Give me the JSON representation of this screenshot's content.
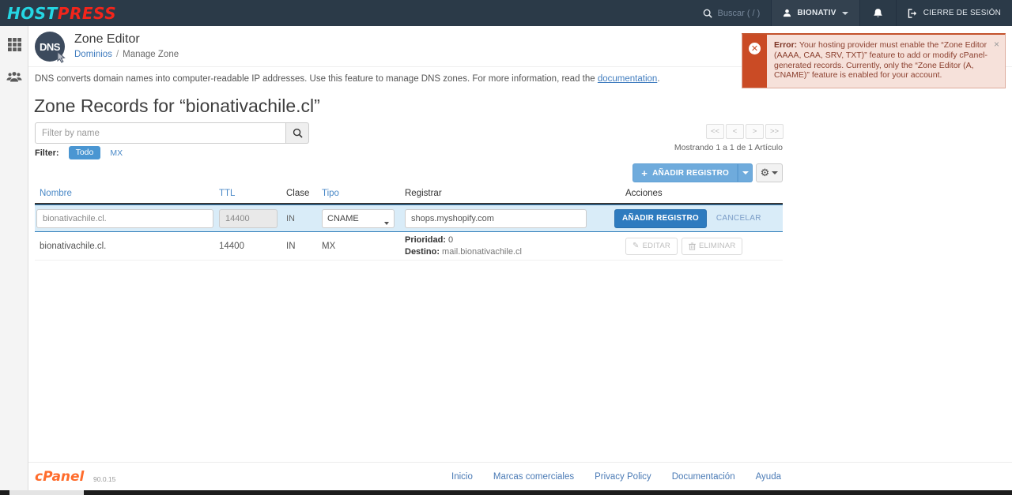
{
  "colors": {
    "topbar_bg": "#2b3a48",
    "logo_cyan": "#25d6e3",
    "logo_red": "#f3251b",
    "link_blue": "#417dbf",
    "primary_button": "#2e7bbf",
    "light_add_button": "#6fabdc",
    "alert_red": "#ca4b25",
    "alert_bg": "#f6e1da",
    "edit_row_bg": "#d9ecf8",
    "cpanel_orange": "#ff6c2c"
  },
  "topbar": {
    "logo_part1": "HOST",
    "logo_part2": "PRESS",
    "search_placeholder": "Buscar ( / )",
    "user_label": "BIONATIV",
    "logout_label": "CIERRE DE SESIÓN"
  },
  "header": {
    "badge_text": "DNS",
    "title": "Zone Editor",
    "breadcrumb_link": "Dominios",
    "breadcrumb_sep": "/",
    "breadcrumb_current": "Manage Zone"
  },
  "alert": {
    "label": "Error:",
    "message": " Your hosting provider must enable the “Zone Editor (AAAA, CAA, SRV, TXT)” feature to add or modify cPanel-generated records. Currently, only the “Zone Editor (A, CNAME)” feature is enabled for your account.",
    "close": "×",
    "icon_glyph": "✕"
  },
  "intro": {
    "text_before": "DNS converts domain names into computer-readable IP addresses. Use this feature to manage DNS zones. For more information, read the ",
    "link": "documentation",
    "text_after": "."
  },
  "zone": {
    "title": "Zone Records for “bionativachile.cl”",
    "filter_placeholder": "Filter by name",
    "filter_label": "Filter:",
    "filter_all": "Todo",
    "filter_mx": "MX",
    "add_record_label": "AÑADIR REGISTRO"
  },
  "pagination": {
    "first": "<<",
    "prev": "<",
    "next": ">",
    "last": ">>",
    "summary": "Mostrando 1 a 1 de 1 Artículo"
  },
  "table": {
    "headers": [
      "Nombre",
      "TTL",
      "Clase",
      "Tipo",
      "Registrar",
      "Acciones"
    ],
    "edit_row": {
      "name": "bionativachile.cl.",
      "ttl": "14400",
      "class": "IN",
      "type": "CNAME",
      "record": "shops.myshopify.com",
      "submit": "AÑADIR REGISTRO",
      "cancel": "CANCELAR"
    },
    "row": {
      "name": "bionativachile.cl.",
      "ttl": "14400",
      "class": "IN",
      "type": "MX",
      "priority_label": "Prioridad:",
      "priority_value": " 0",
      "dest_label": "Destino:",
      "dest_value": " mail.bionativachile.cl",
      "edit": "EDITAR",
      "delete": "ELIMINAR",
      "pencil_glyph": "✎"
    }
  },
  "footer": {
    "brand": "cPanel",
    "version": "90.0.15",
    "links": [
      "Inicio",
      "Marcas comerciales",
      "Privacy Policy",
      "Documentación",
      "Ayuda"
    ]
  }
}
